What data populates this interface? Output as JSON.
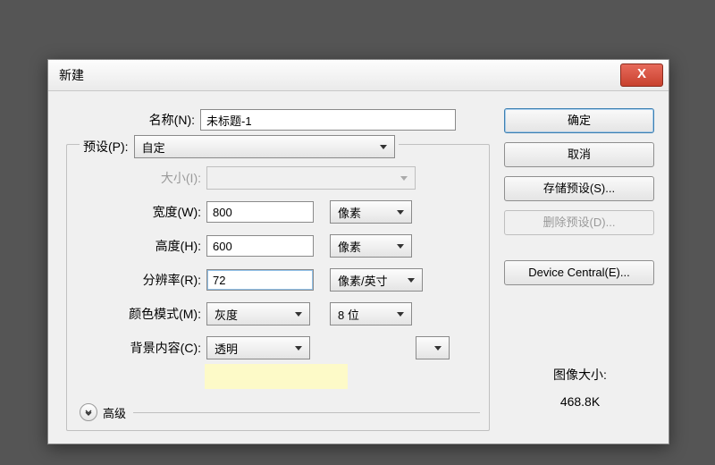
{
  "dialog": {
    "title": "新建",
    "close_glyph": "X"
  },
  "form": {
    "name_label": "名称(N):",
    "name_value": "未标题-1",
    "preset_label": "预设(P):",
    "preset_value": "自定",
    "size_label": "大小(I):",
    "size_value": "",
    "width_label": "宽度(W):",
    "width_value": "800",
    "width_unit": "像素",
    "height_label": "高度(H):",
    "height_value": "600",
    "height_unit": "像素",
    "res_label": "分辨率(R):",
    "res_value": "72",
    "res_unit": "像素/英寸",
    "mode_label": "颜色模式(M):",
    "mode_value": "灰度",
    "depth_value": "8 位",
    "bg_label": "背景内容(C):",
    "bg_value": "透明",
    "advanced_label": "高级"
  },
  "buttons": {
    "ok": "确定",
    "cancel": "取消",
    "save_preset": "存储预设(S)...",
    "delete_preset": "删除预设(D)...",
    "device_central": "Device Central(E)..."
  },
  "image_size": {
    "label": "图像大小:",
    "value": "468.8K"
  }
}
